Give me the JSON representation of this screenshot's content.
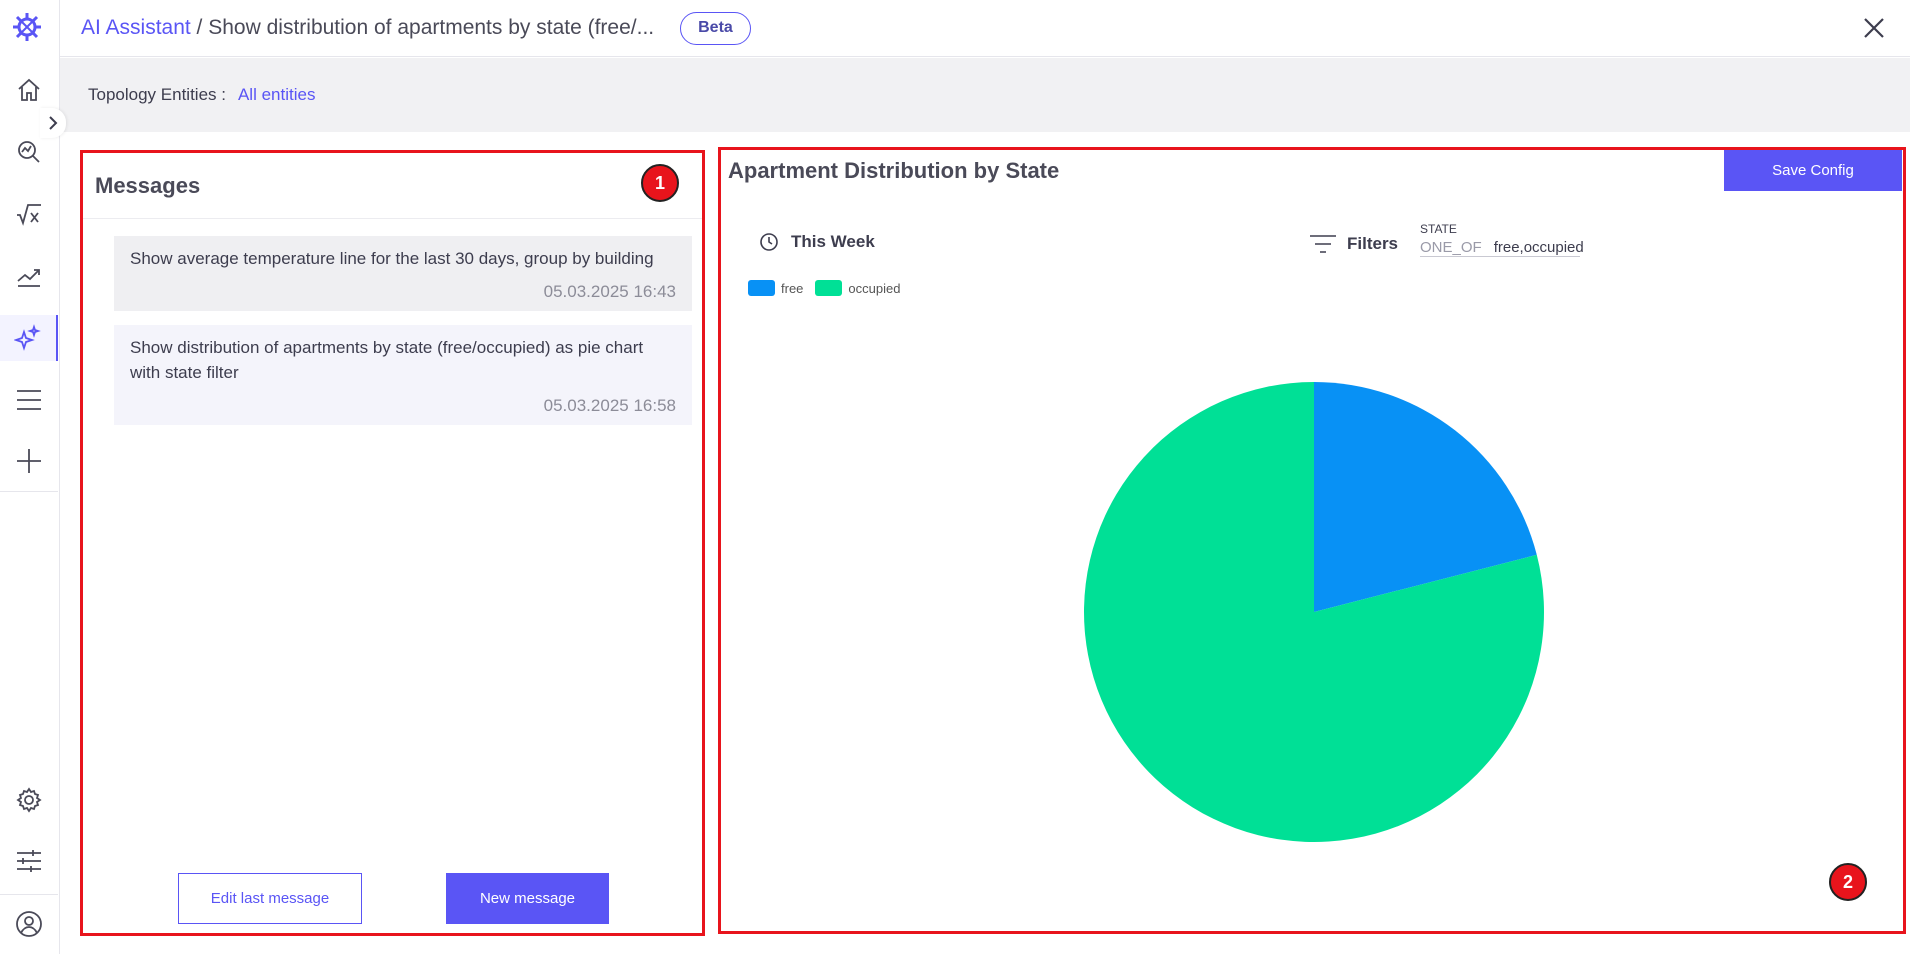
{
  "header": {
    "app_link": "AI Assistant",
    "separator": " / ",
    "title": "Show distribution of apartments by state (free/...",
    "beta_badge": "Beta"
  },
  "filter_bar": {
    "label": "Topology Entities :",
    "value": "All entities"
  },
  "messages_panel": {
    "title": "Messages",
    "annotation": "1",
    "messages": [
      {
        "text": "Show average temperature line for the last 30 days, group by building",
        "time": "05.03.2025 16:43"
      },
      {
        "text": "Show distribution of apartments by state (free/occupied) as pie chart with state filter",
        "time": "05.03.2025 16:58"
      }
    ],
    "edit_button": "Edit last message",
    "new_button": "New message"
  },
  "chart_panel": {
    "title": "Apartment Distribution by State",
    "save_button": "Save Config",
    "time_range": "This Week",
    "filters_label": "Filters",
    "state_filter": {
      "key": "STATE",
      "operator": "ONE_OF",
      "value": "free,occupied"
    },
    "annotation": "2"
  },
  "chart_data": {
    "type": "pie",
    "title": "Apartment Distribution by State",
    "categories": [
      "free",
      "occupied"
    ],
    "values": [
      21,
      79
    ],
    "colors": [
      "#0891f5",
      "#00e096"
    ],
    "legend": "top-left"
  },
  "rail": {
    "icons": [
      "logo-icon",
      "home-icon",
      "search-chart-icon",
      "formula-icon",
      "trend-icon",
      "ai-sparkle-icon",
      "menu-icon",
      "plus-icon",
      "settings-icon",
      "sliders-icon",
      "user-icon"
    ],
    "accent": "#5a55f5"
  }
}
